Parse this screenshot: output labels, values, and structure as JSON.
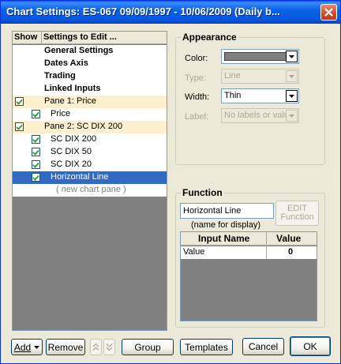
{
  "window": {
    "title": "Chart Settings:  ES-067  09/09/1997 - 10/06/2009  (Daily b..."
  },
  "list": {
    "header_show": "Show",
    "header_settings": "Settings to Edit ...",
    "rows": [
      {
        "label": "General Settings",
        "bold": true
      },
      {
        "label": "Dates Axis",
        "bold": true
      },
      {
        "label": "Trading",
        "bold": true
      },
      {
        "label": "Linked Inputs",
        "bold": true
      },
      {
        "label": "Pane 1:  Price",
        "checked": true,
        "pane": true
      },
      {
        "label": "Price",
        "checked": true
      },
      {
        "label": "Pane 2:  SC DIX 200",
        "checked": true,
        "pane": true
      },
      {
        "label": "SC DIX 200",
        "checked": true
      },
      {
        "label": "SC DIX 50",
        "checked": true
      },
      {
        "label": "SC DIX 20",
        "checked": true
      },
      {
        "label": "Horizontal Line",
        "checked": true,
        "selected": true
      },
      {
        "label": "( new chart pane )",
        "muted": true
      }
    ]
  },
  "appearance": {
    "title": "Appearance",
    "color_label": "Color:",
    "color_value": "#808080",
    "type_label": "Type:",
    "type_value": "Line",
    "width_label": "Width:",
    "width_value": "Thin",
    "label_label": "Label:",
    "label_value": "No labels or value"
  },
  "function": {
    "title": "Function",
    "name_value": "Horizontal Line",
    "name_hint": "(name for display)",
    "edit_line1": "EDIT",
    "edit_line2": "Function",
    "col_input": "Input Name",
    "col_value": "Value",
    "inputs": [
      {
        "name": "Value",
        "value": "0"
      }
    ]
  },
  "buttons": {
    "add": "Add",
    "remove": "Remove",
    "group": "Group",
    "templates": "Templates",
    "cancel": "Cancel",
    "ok": "OK"
  },
  "colors": {
    "selection": "#316ac5",
    "pane_row": "#fdf0cd",
    "title_bar": "#0a63e9",
    "close_button": "#d14a2a"
  }
}
